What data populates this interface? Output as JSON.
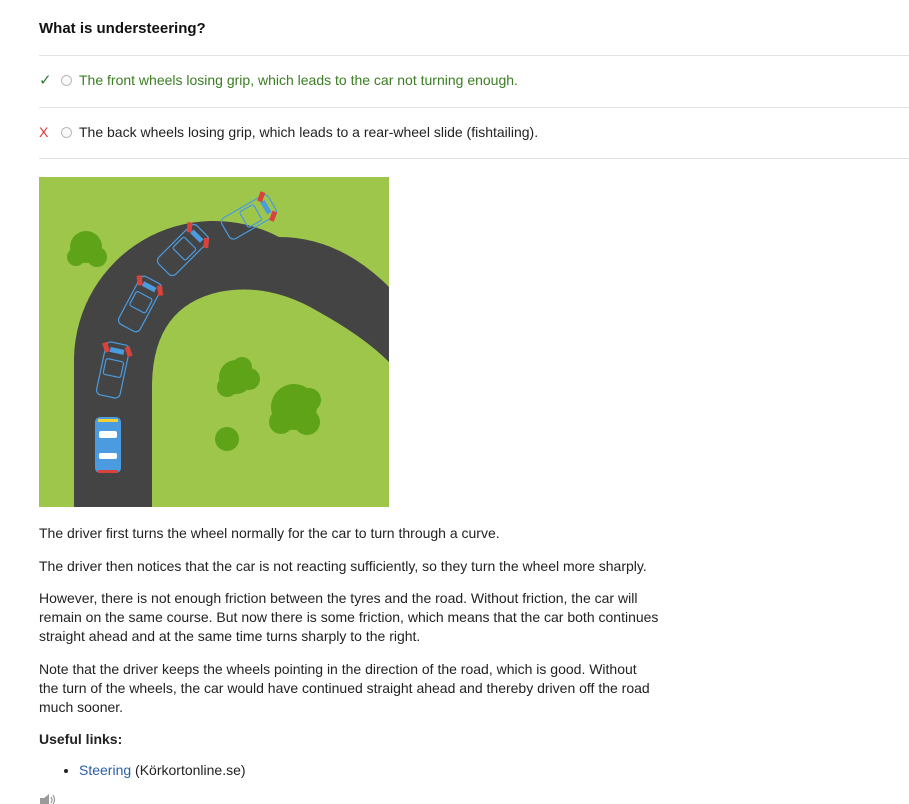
{
  "question": {
    "title": "What is understeering?"
  },
  "answers": [
    {
      "mark": "✓",
      "status": "correct",
      "text": "The front wheels losing grip, which leads to the car not turning enough."
    },
    {
      "mark": "X",
      "status": "incorrect",
      "text": "The back wheels losing grip, which leads to a rear-wheel slide (fishtailing)."
    }
  ],
  "colors": {
    "grass": "#9dc64a",
    "road": "#444444",
    "bush": "#5fa319",
    "car": "#4a9be0",
    "correct": "#3a7d22",
    "incorrect": "#e53935",
    "link": "#2a5fa8"
  },
  "explanation": [
    "The driver first turns the wheel normally for the car to turn through a curve.",
    "The driver then notices that the car is not reacting sufficiently, so they turn the wheel more sharply.",
    "However, there is not enough friction between the tyres and the road. Without friction, the car will remain on the same course. But now there is some friction, which means that the car both continues straight ahead and at the same time turns sharply to the right.",
    "Note that the driver keeps the wheels pointing in the direction of the road, which is good. Without the turn of the wheels, the car would have continued straight ahead and thereby driven off the road much sooner."
  ],
  "links": {
    "heading": "Useful links:",
    "items": [
      {
        "label": "Steering",
        "source": " (Körkortonline.se)"
      }
    ]
  },
  "icons": {
    "speaker": "speaker-icon"
  }
}
